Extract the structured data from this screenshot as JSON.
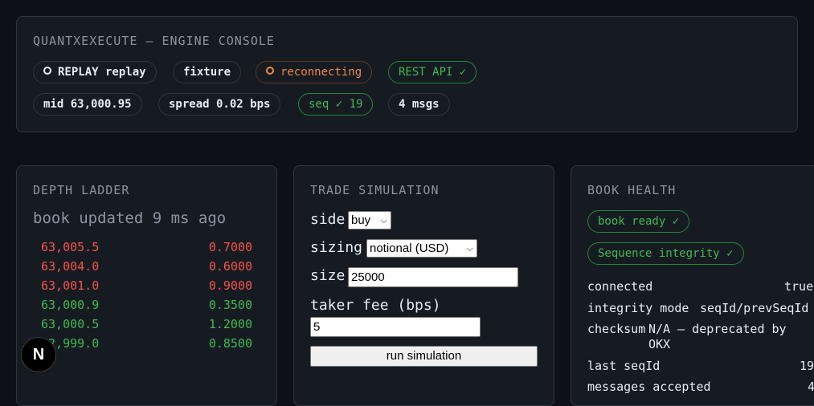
{
  "console": {
    "title": "QUANTXEXECUTE — ENGINE CONSOLE",
    "pills_row1": [
      {
        "label": "REPLAY replay",
        "state": "dot"
      },
      {
        "label": "fixture"
      },
      {
        "label": "reconnecting",
        "state": "orange"
      },
      {
        "label": "REST API ✓",
        "state": "green"
      }
    ],
    "pills_row2": [
      {
        "label": "mid 63,000.95"
      },
      {
        "label": "spread 0.02 bps"
      },
      {
        "label": "seq ✓ 19",
        "state": "green"
      },
      {
        "label": "4 msgs"
      }
    ]
  },
  "depth": {
    "title": "DEPTH LADDER",
    "subtitle": "book updated 9 ms ago",
    "asks": [
      {
        "price": "63,005.5",
        "qty": "0.7000"
      },
      {
        "price": "63,004.0",
        "qty": "0.6000"
      },
      {
        "price": "63,001.0",
        "qty": "0.9000"
      }
    ],
    "bids": [
      {
        "price": "63,000.9",
        "qty": "0.3500"
      },
      {
        "price": "63,000.5",
        "qty": "1.2000"
      },
      {
        "price": "62,999.0",
        "qty": "0.8500"
      }
    ]
  },
  "sim": {
    "title": "TRADE SIMULATION",
    "side_label": "side",
    "side_value": "buy",
    "sizing_label": "sizing",
    "sizing_value": "notional (USD)",
    "size_label": "size",
    "size_value": "25000",
    "fee_label": "taker fee (bps)",
    "fee_value": "5",
    "run_label": "run simulation"
  },
  "health": {
    "title": "BOOK HEALTH",
    "badge_ready": "book ready ✓",
    "badge_seq": "Sequence integrity ✓",
    "rows": [
      {
        "key": "connected",
        "value": "true"
      },
      {
        "key": "integrity mode",
        "value": "seqId/prevSeqId"
      },
      {
        "key": "checksum",
        "value": "N/A — deprecated by",
        "value2": "OKX"
      },
      {
        "key": "last seqId",
        "value": "19"
      },
      {
        "key": "messages accepted",
        "value": "4"
      }
    ]
  },
  "overlay": {
    "nextjs_glyph": "N"
  },
  "colors": {
    "accent_green": "#3fb950",
    "accent_red": "#f85149",
    "accent_orange": "#f0883e"
  }
}
